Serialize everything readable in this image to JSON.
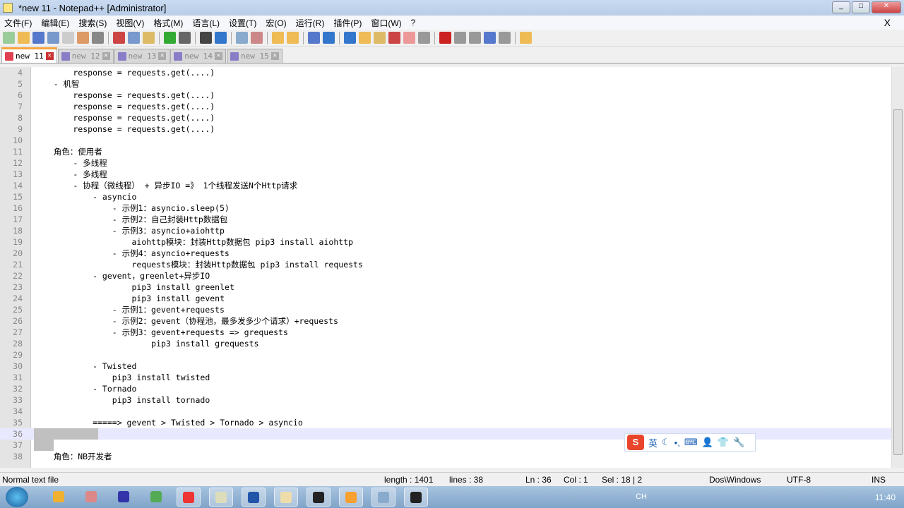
{
  "window": {
    "title": "*new 11 - Notepad++ [Administrator]"
  },
  "menu": [
    "文件(F)",
    "编辑(E)",
    "搜索(S)",
    "视图(V)",
    "格式(M)",
    "语言(L)",
    "设置(T)",
    "宏(O)",
    "运行(R)",
    "插件(P)",
    "窗口(W)",
    "?"
  ],
  "menu_close": "X",
  "tabs": [
    {
      "label": "new 11",
      "active": true
    },
    {
      "label": "new 12"
    },
    {
      "label": "new 13"
    },
    {
      "label": "new 14"
    },
    {
      "label": "new 15"
    }
  ],
  "editor": {
    "first_line": 4,
    "current_line": 36,
    "lines": [
      "        response = requests.get(....)",
      "    - 机智",
      "        response = requests.get(....)",
      "        response = requests.get(....)",
      "        response = requests.get(....)",
      "        response = requests.get(....)",
      "",
      "    角色：使用者",
      "        - 多线程",
      "        - 多线程",
      "        - 协程（微线程） + 异步IO =》 1个线程发送N个Http请求",
      "            - asyncio",
      "                - 示例1：asyncio.sleep(5)",
      "                - 示例2：自己封装Http数据包",
      "                - 示例3：asyncio+aiohttp",
      "                    aiohttp模块：封装Http数据包 pip3 install aiohttp",
      "                - 示例4：asyncio+requests",
      "                    requests模块：封装Http数据包 pip3 install requests",
      "            - gevent，greenlet+异步IO",
      "                    pip3 install greenlet",
      "                    pip3 install gevent",
      "                - 示例1：gevent+requests",
      "                - 示例2：gevent（协程池，最多发多少个请求）+requests",
      "                - 示例3：gevent+requests => grequests",
      "                        pip3 install grequests",
      "",
      "            - Twisted",
      "                pip3 install twisted",
      "            - Tornado",
      "                pip3 install tornado",
      "",
      "            =====> gevent > Twisted > Tornado > asyncio",
      "",
      "",
      "    角色：NB开发者"
    ]
  },
  "ime": {
    "logo": "S",
    "mode": "英"
  },
  "status": {
    "type": "Normal text file",
    "length": "length : 1401",
    "lines": "lines : 38",
    "ln": "Ln : 36",
    "col": "Col : 1",
    "sel": "Sel : 18 | 2",
    "eol": "Dos\\Windows",
    "encoding": "UTF-8",
    "ins": "INS"
  },
  "taskbar": {
    "tray_lang": "CH",
    "clock": "11:40"
  }
}
